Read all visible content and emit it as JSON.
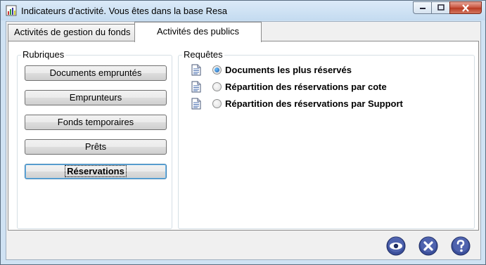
{
  "window": {
    "title": "Indicateurs d'activité.  Vous êtes dans la base Resa"
  },
  "tabs": [
    {
      "label": "Activités de gestion du fonds",
      "active": false
    },
    {
      "label": "Activités des publics",
      "active": true
    }
  ],
  "rubriques": {
    "legend": "Rubriques",
    "items": [
      {
        "label": "Documents empruntés",
        "selected": false
      },
      {
        "label": "Emprunteurs",
        "selected": false
      },
      {
        "label": "Fonds temporaires",
        "selected": false
      },
      {
        "label": "Prêts",
        "selected": false
      },
      {
        "label": "Réservations",
        "selected": true
      }
    ]
  },
  "requetes": {
    "legend": "Requêtes",
    "items": [
      {
        "label": "Documents les plus réservés",
        "checked": true,
        "icon": "document-icon"
      },
      {
        "label": "Répartition des réservations par cote",
        "checked": false,
        "icon": "document-icon"
      },
      {
        "label": "Répartition des réservations par Support",
        "checked": false,
        "icon": "document-icon"
      }
    ]
  },
  "footer": {
    "buttons": [
      {
        "icon": "eye-icon",
        "color": "#3b4f9a"
      },
      {
        "icon": "close-x-icon",
        "color": "#3b4f9a"
      },
      {
        "icon": "help-icon",
        "color": "#3b4f9a"
      }
    ]
  }
}
